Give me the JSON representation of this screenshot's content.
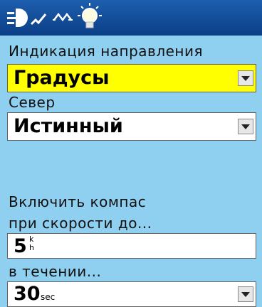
{
  "header": {
    "icons": [
      "backlight-icon",
      "signal-icon",
      "bulb-icon"
    ],
    "color": "#0b3f86"
  },
  "heading_display": {
    "label": "Индикация направления",
    "value": "Градусы",
    "highlight_color": "#ffff00"
  },
  "north": {
    "label": "Север",
    "value": "Истинный"
  },
  "compass_speed": {
    "label_line1": "Включить компас",
    "label_line2": "при скорости до...",
    "value": "5",
    "unit_top": "k",
    "unit_bottom": "h"
  },
  "duration": {
    "label": "в течении...",
    "value": "30",
    "unit": "sec"
  },
  "background_color": "#8fd0f0"
}
